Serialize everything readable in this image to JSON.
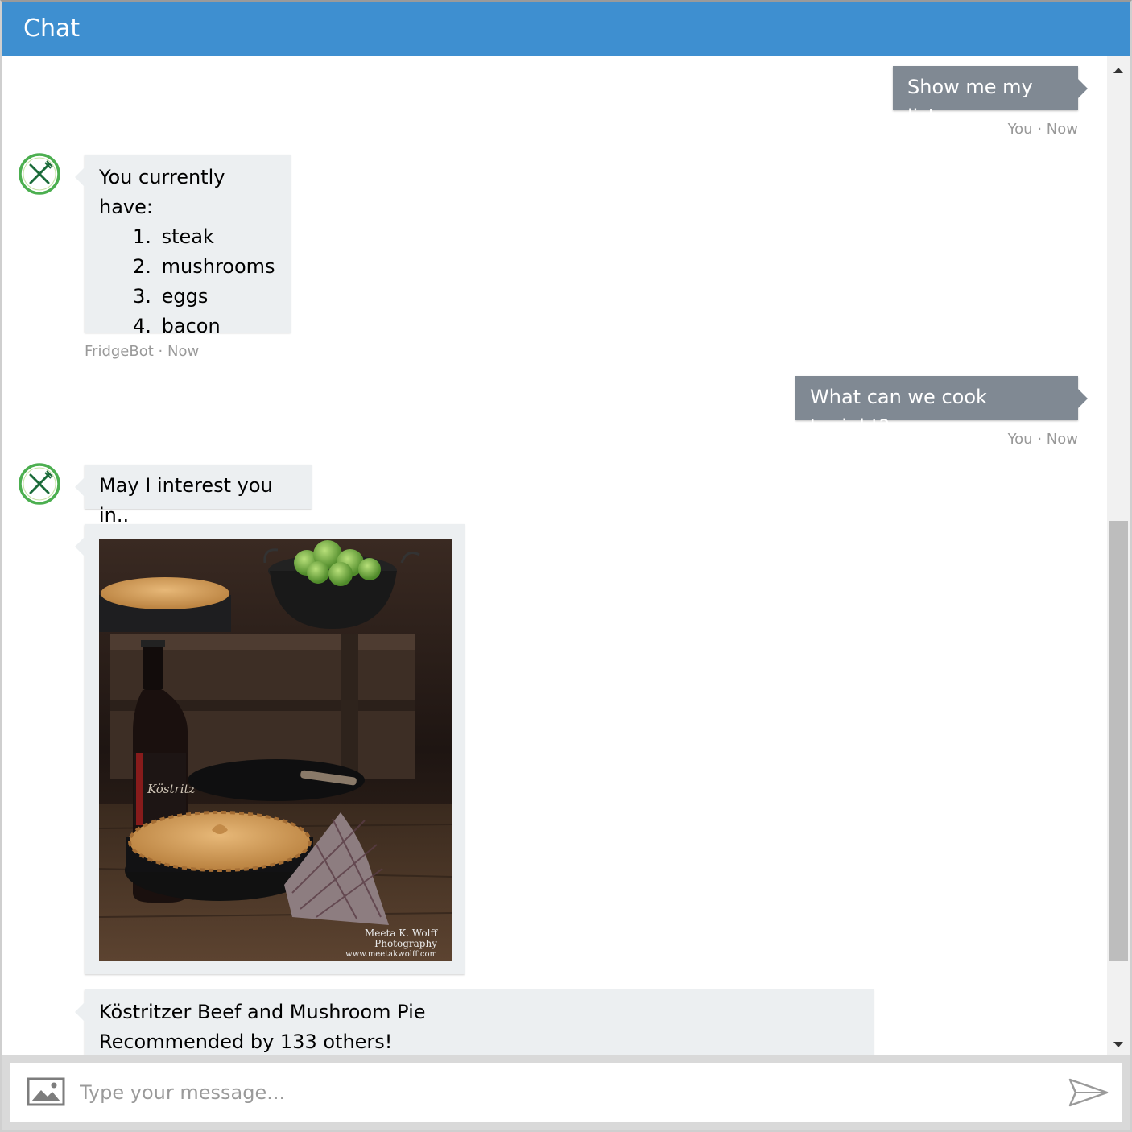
{
  "header": {
    "title": "Chat"
  },
  "messages": {
    "m1": {
      "text": "Show me my list.",
      "sender": "You",
      "time": "Now"
    },
    "m2": {
      "intro": "You currently have:",
      "items": [
        {
          "num": "1.",
          "label": "steak"
        },
        {
          "num": "2.",
          "label": "mushrooms"
        },
        {
          "num": "3.",
          "label": "eggs"
        },
        {
          "num": "4.",
          "label": "bacon"
        }
      ],
      "sender": "FridgeBot",
      "time": "Now"
    },
    "m3": {
      "text": "What can we cook tonight?",
      "sender": "You",
      "time": "Now"
    },
    "m4": {
      "text": "May I interest you in.."
    },
    "m5": {
      "bottle_label": "Köstritz",
      "credit_line1": "Meeta K. Wolff",
      "credit_line2": "Photography",
      "credit_line3": "www.meetakwolff.com"
    },
    "m6": {
      "title": "Köstritzer Beef and Mushroom Pie",
      "subtitle": "Recommended by 133 others!"
    }
  },
  "separator": "·",
  "input": {
    "placeholder": "Type your message..."
  },
  "icons": {
    "avatar": "fork-knife-icon",
    "attach": "image-icon",
    "send": "send-icon",
    "scroll_up": "arrow-up-icon",
    "scroll_down": "arrow-down-icon"
  },
  "colors": {
    "header": "#3e8fd0",
    "user_bubble": "#808993",
    "bot_bubble": "#eceff1",
    "avatar_ring": "#4caf50"
  }
}
